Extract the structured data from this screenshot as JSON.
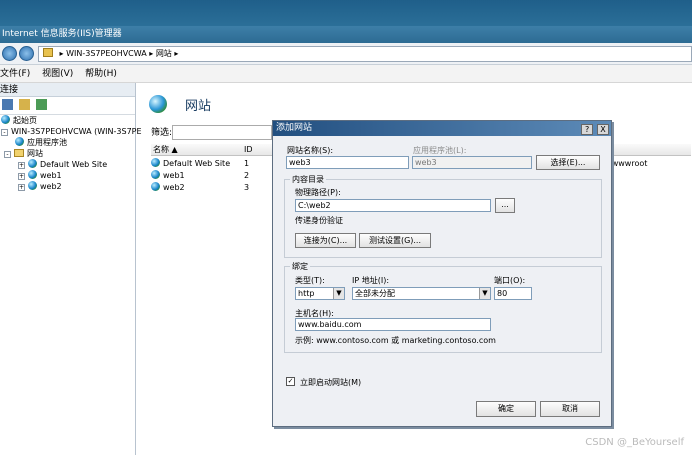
{
  "window": {
    "title": "Internet 信息服务(IIS)管理器"
  },
  "addressbar": {
    "crumbs": [
      "WIN-3S7PEOHVCWA",
      "网站"
    ],
    "separators": [
      "▸",
      "▸",
      "▸"
    ]
  },
  "menu": {
    "items": [
      "文件(F)",
      "视图(V)",
      "帮助(H)"
    ]
  },
  "leftpane": {
    "header": "连接",
    "tree": {
      "start_page": "起始页",
      "server": "WIN-3S7PEOHVCWA (WIN-3S7PE",
      "app_pools": "应用程序池",
      "sites": "网站",
      "site_items": [
        "Default Web Site",
        "web1",
        "web2"
      ]
    }
  },
  "main": {
    "title": "网站",
    "filter_label": "筛选:",
    "columns": [
      "名称 ▲",
      "ID"
    ],
    "rows": [
      {
        "name": "Default Web Site",
        "id": "1",
        "path": "\\wwwroot"
      },
      {
        "name": "web1",
        "id": "2",
        "path": ""
      },
      {
        "name": "web2",
        "id": "3",
        "path": ""
      }
    ]
  },
  "dialog": {
    "title": "添加网站",
    "help_button": "?",
    "close_button": "X",
    "site_name_label": "网站名称(S):",
    "site_name_value": "web3",
    "app_pool_label": "应用程序池(L):",
    "app_pool_value": "web3",
    "select_button": "选择(E)...",
    "content_group": "内容目录",
    "physical_path_label": "物理路径(P):",
    "physical_path_value": "C:\\web2",
    "browse_button": "...",
    "pass_auth_label": "传递身份验证",
    "connect_as_button": "连接为(C)...",
    "test_settings_button": "测试设置(G)...",
    "binding_group": "绑定",
    "type_label": "类型(T):",
    "type_value": "http",
    "ip_label": "IP 地址(I):",
    "ip_value": "全部未分配",
    "port_label": "端口(O):",
    "port_value": "80",
    "host_label": "主机名(H):",
    "host_value": "www.baidu.com",
    "example_text": "示例: www.contoso.com 或 marketing.contoso.com",
    "start_immediately_label": "立即启动网站(M)",
    "ok_button": "确定",
    "cancel_button": "取消"
  },
  "watermark": "CSDN @_BeYourself"
}
